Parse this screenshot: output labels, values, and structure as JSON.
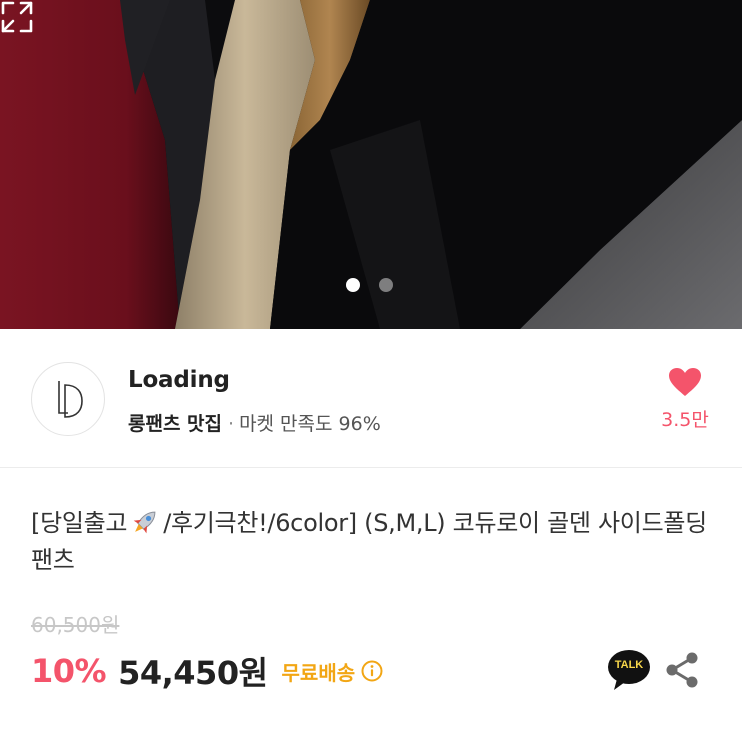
{
  "gallery": {
    "page_count": 2,
    "active_index": 0,
    "expand_icon": "expand-icon"
  },
  "seller": {
    "name": "Loading",
    "category": "롱팬츠 맛집",
    "separator": "·",
    "satisfaction": "마켓 만족도 96%",
    "like_count": "3.5만",
    "like_color": "#f4546b",
    "logo_text": "LD"
  },
  "product": {
    "title_before_icon": "[당일출고",
    "title_icon": "rocket-icon",
    "title_after_icon": "/후기극찬!/6color] (S,M,L) 코듀로이 골덴 사이드폴딩 팬츠",
    "original_price": "60,500원",
    "discount": "10%",
    "price": "54,450원",
    "shipping": "무료배송",
    "shipping_color": "#f2a614",
    "talk_label": "TALK"
  }
}
